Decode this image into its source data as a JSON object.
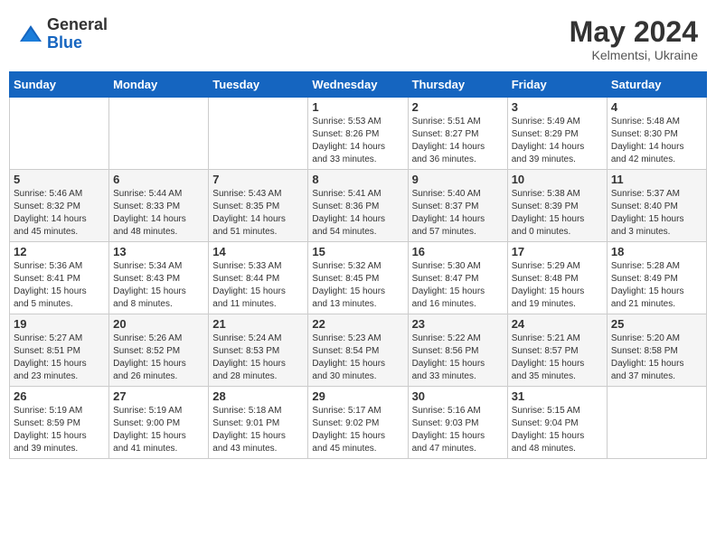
{
  "header": {
    "logo_general": "General",
    "logo_blue": "Blue",
    "month_year": "May 2024",
    "location": "Kelmentsi, Ukraine"
  },
  "weekdays": [
    "Sunday",
    "Monday",
    "Tuesday",
    "Wednesday",
    "Thursday",
    "Friday",
    "Saturday"
  ],
  "weeks": [
    [
      {
        "day": "",
        "info": ""
      },
      {
        "day": "",
        "info": ""
      },
      {
        "day": "",
        "info": ""
      },
      {
        "day": "1",
        "info": "Sunrise: 5:53 AM\nSunset: 8:26 PM\nDaylight: 14 hours\nand 33 minutes."
      },
      {
        "day": "2",
        "info": "Sunrise: 5:51 AM\nSunset: 8:27 PM\nDaylight: 14 hours\nand 36 minutes."
      },
      {
        "day": "3",
        "info": "Sunrise: 5:49 AM\nSunset: 8:29 PM\nDaylight: 14 hours\nand 39 minutes."
      },
      {
        "day": "4",
        "info": "Sunrise: 5:48 AM\nSunset: 8:30 PM\nDaylight: 14 hours\nand 42 minutes."
      }
    ],
    [
      {
        "day": "5",
        "info": "Sunrise: 5:46 AM\nSunset: 8:32 PM\nDaylight: 14 hours\nand 45 minutes."
      },
      {
        "day": "6",
        "info": "Sunrise: 5:44 AM\nSunset: 8:33 PM\nDaylight: 14 hours\nand 48 minutes."
      },
      {
        "day": "7",
        "info": "Sunrise: 5:43 AM\nSunset: 8:35 PM\nDaylight: 14 hours\nand 51 minutes."
      },
      {
        "day": "8",
        "info": "Sunrise: 5:41 AM\nSunset: 8:36 PM\nDaylight: 14 hours\nand 54 minutes."
      },
      {
        "day": "9",
        "info": "Sunrise: 5:40 AM\nSunset: 8:37 PM\nDaylight: 14 hours\nand 57 minutes."
      },
      {
        "day": "10",
        "info": "Sunrise: 5:38 AM\nSunset: 8:39 PM\nDaylight: 15 hours\nand 0 minutes."
      },
      {
        "day": "11",
        "info": "Sunrise: 5:37 AM\nSunset: 8:40 PM\nDaylight: 15 hours\nand 3 minutes."
      }
    ],
    [
      {
        "day": "12",
        "info": "Sunrise: 5:36 AM\nSunset: 8:41 PM\nDaylight: 15 hours\nand 5 minutes."
      },
      {
        "day": "13",
        "info": "Sunrise: 5:34 AM\nSunset: 8:43 PM\nDaylight: 15 hours\nand 8 minutes."
      },
      {
        "day": "14",
        "info": "Sunrise: 5:33 AM\nSunset: 8:44 PM\nDaylight: 15 hours\nand 11 minutes."
      },
      {
        "day": "15",
        "info": "Sunrise: 5:32 AM\nSunset: 8:45 PM\nDaylight: 15 hours\nand 13 minutes."
      },
      {
        "day": "16",
        "info": "Sunrise: 5:30 AM\nSunset: 8:47 PM\nDaylight: 15 hours\nand 16 minutes."
      },
      {
        "day": "17",
        "info": "Sunrise: 5:29 AM\nSunset: 8:48 PM\nDaylight: 15 hours\nand 19 minutes."
      },
      {
        "day": "18",
        "info": "Sunrise: 5:28 AM\nSunset: 8:49 PM\nDaylight: 15 hours\nand 21 minutes."
      }
    ],
    [
      {
        "day": "19",
        "info": "Sunrise: 5:27 AM\nSunset: 8:51 PM\nDaylight: 15 hours\nand 23 minutes."
      },
      {
        "day": "20",
        "info": "Sunrise: 5:26 AM\nSunset: 8:52 PM\nDaylight: 15 hours\nand 26 minutes."
      },
      {
        "day": "21",
        "info": "Sunrise: 5:24 AM\nSunset: 8:53 PM\nDaylight: 15 hours\nand 28 minutes."
      },
      {
        "day": "22",
        "info": "Sunrise: 5:23 AM\nSunset: 8:54 PM\nDaylight: 15 hours\nand 30 minutes."
      },
      {
        "day": "23",
        "info": "Sunrise: 5:22 AM\nSunset: 8:56 PM\nDaylight: 15 hours\nand 33 minutes."
      },
      {
        "day": "24",
        "info": "Sunrise: 5:21 AM\nSunset: 8:57 PM\nDaylight: 15 hours\nand 35 minutes."
      },
      {
        "day": "25",
        "info": "Sunrise: 5:20 AM\nSunset: 8:58 PM\nDaylight: 15 hours\nand 37 minutes."
      }
    ],
    [
      {
        "day": "26",
        "info": "Sunrise: 5:19 AM\nSunset: 8:59 PM\nDaylight: 15 hours\nand 39 minutes."
      },
      {
        "day": "27",
        "info": "Sunrise: 5:19 AM\nSunset: 9:00 PM\nDaylight: 15 hours\nand 41 minutes."
      },
      {
        "day": "28",
        "info": "Sunrise: 5:18 AM\nSunset: 9:01 PM\nDaylight: 15 hours\nand 43 minutes."
      },
      {
        "day": "29",
        "info": "Sunrise: 5:17 AM\nSunset: 9:02 PM\nDaylight: 15 hours\nand 45 minutes."
      },
      {
        "day": "30",
        "info": "Sunrise: 5:16 AM\nSunset: 9:03 PM\nDaylight: 15 hours\nand 47 minutes."
      },
      {
        "day": "31",
        "info": "Sunrise: 5:15 AM\nSunset: 9:04 PM\nDaylight: 15 hours\nand 48 minutes."
      },
      {
        "day": "",
        "info": ""
      }
    ]
  ]
}
